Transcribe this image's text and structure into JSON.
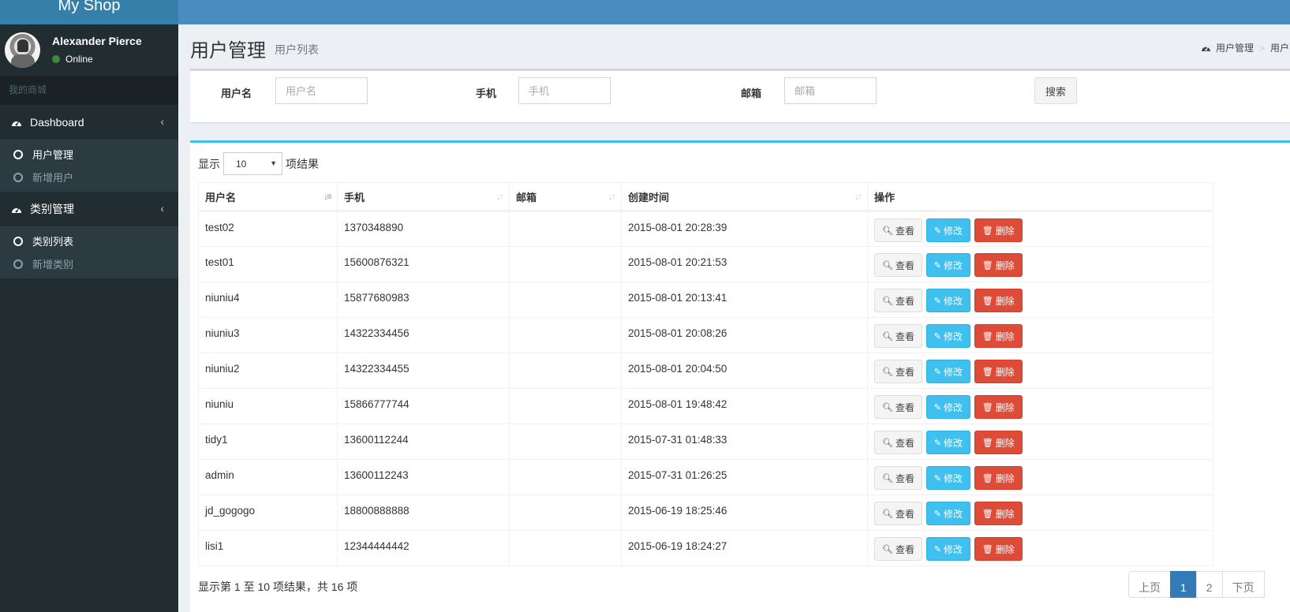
{
  "app": {
    "logo": "My Shop",
    "brand_color": "#367fa9",
    "navbar_color": "#4a8cbf"
  },
  "user": {
    "name": "Alexander Pierce",
    "status": "Online",
    "status_color": "#3c8a3c"
  },
  "sidebar": {
    "header": "我的商城",
    "groups": [
      {
        "label": "Dashboard",
        "icon": "dashboard-icon",
        "items": [
          {
            "label": "用户管理",
            "active": true
          },
          {
            "label": "新增用户",
            "active": false
          }
        ]
      },
      {
        "label": "类别管理",
        "icon": "dashboard-icon",
        "items": [
          {
            "label": "类别列表",
            "active": true
          },
          {
            "label": "新增类别",
            "active": false
          }
        ]
      }
    ]
  },
  "page": {
    "title": "用户管理",
    "subtitle": "用户列表"
  },
  "breadcrumb": {
    "items": [
      "用户管理",
      "用户列表"
    ],
    "separator": ">"
  },
  "search": {
    "fields": [
      {
        "label": "用户名",
        "placeholder": "用户名",
        "value": ""
      },
      {
        "label": "手机",
        "placeholder": "手机",
        "value": ""
      },
      {
        "label": "邮箱",
        "placeholder": "邮箱",
        "value": ""
      }
    ],
    "button": "搜索"
  },
  "table": {
    "length_prefix": "显示",
    "length_value": "10",
    "length_suffix": "项结果",
    "columns": [
      "用户名",
      "手机",
      "邮箱",
      "创建时间",
      "操作"
    ],
    "actions": {
      "view": "查看",
      "edit": "修改",
      "delete": "删除"
    },
    "rows": [
      {
        "username": "test02",
        "phone": "1370348890",
        "email": "",
        "created": "2015-08-01 20:28:39"
      },
      {
        "username": "test01",
        "phone": "15600876321",
        "email": "",
        "created": "2015-08-01 20:21:53"
      },
      {
        "username": "niuniu4",
        "phone": "15877680983",
        "email": "",
        "created": "2015-08-01 20:13:41"
      },
      {
        "username": "niuniu3",
        "phone": "14322334456",
        "email": "",
        "created": "2015-08-01 20:08:26"
      },
      {
        "username": "niuniu2",
        "phone": "14322334455",
        "email": "",
        "created": "2015-08-01 20:04:50"
      },
      {
        "username": "niuniu",
        "phone": "15866777744",
        "email": "",
        "created": "2015-08-01 19:48:42"
      },
      {
        "username": "tidy1",
        "phone": "13600112244",
        "email": "",
        "created": "2015-07-31 01:48:33"
      },
      {
        "username": "admin",
        "phone": "13600112243",
        "email": "",
        "created": "2015-07-31 01:26:25"
      },
      {
        "username": "jd_gogogo",
        "phone": "18800888888",
        "email": "",
        "created": "2015-06-19 18:25:46"
      },
      {
        "username": "lisi1",
        "phone": "12344444442",
        "email": "",
        "created": "2015-06-19 18:24:27"
      }
    ],
    "info": "显示第 1 至 10 项结果，共 16 项",
    "pagination": {
      "prev": "上页",
      "pages": [
        "1",
        "2"
      ],
      "current": "1",
      "next": "下页"
    }
  }
}
